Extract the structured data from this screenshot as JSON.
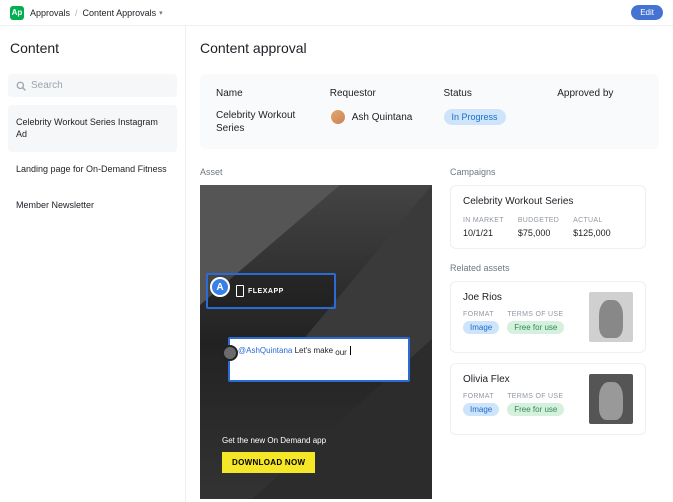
{
  "header": {
    "app_badge": "Ap",
    "crumb1": "Approvals",
    "crumb2": "Content Approvals",
    "edit": "Edit"
  },
  "sidebar": {
    "title": "Content",
    "search_placeholder": "Search",
    "items": [
      "Celebrity Workout Series Instagram Ad",
      "Landing page for On-Demand Fitness",
      "Member Newsletter"
    ]
  },
  "main": {
    "title": "Content approval",
    "summary": {
      "name_lbl": "Name",
      "name_val": "Celebrity Workout Series",
      "req_lbl": "Requestor",
      "req_val": "Ash Quintana",
      "status_lbl": "Status",
      "status_val": "In Progress",
      "appr_lbl": "Approved by"
    },
    "asset_lbl": "Asset",
    "hero_tagline": "Get the new On Demand app",
    "hero_cta": "DOWNLOAD NOW",
    "annot_label": "FLEXAPP",
    "annot_letter": "A",
    "comment_mention": "@AshQuintana",
    "comment_text": " Let's make ",
    "comment_trail": "our",
    "campaigns_lbl": "Campaigns",
    "campaign": {
      "title": "Celebrity Workout Series",
      "kv": [
        {
          "k": "In Market",
          "v": "10/1/21"
        },
        {
          "k": "Budgeted",
          "v": "$75,000"
        },
        {
          "k": "Actual",
          "v": "$125,000"
        }
      ]
    },
    "related_lbl": "Related assets",
    "related": [
      {
        "name": "Joe Rios",
        "format_lbl": "Format",
        "format": "Image",
        "terms_lbl": "Terms of use",
        "terms": "Free for use"
      },
      {
        "name": "Olivia Flex",
        "format_lbl": "Format",
        "format": "Image",
        "terms_lbl": "Terms of use",
        "terms": "Free for use"
      }
    ]
  }
}
